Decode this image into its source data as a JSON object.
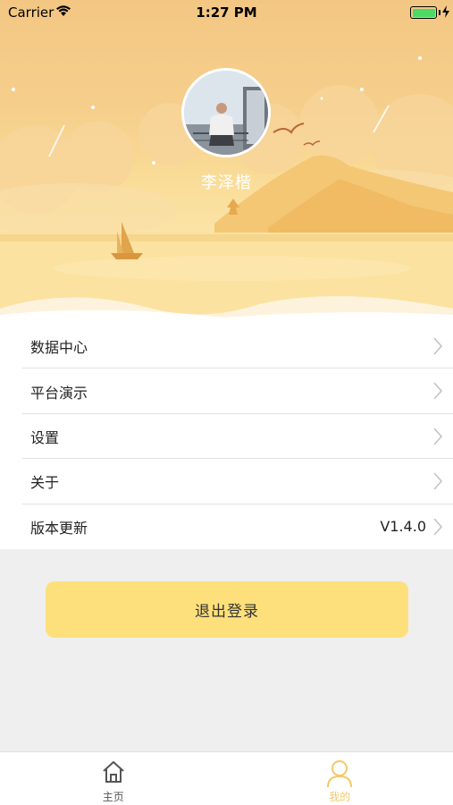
{
  "status_bar": {
    "carrier": "Carrier",
    "time": "1:27 PM"
  },
  "profile": {
    "username": "李泽楷"
  },
  "menu": {
    "items": [
      {
        "label": "数据中心",
        "value": ""
      },
      {
        "label": "平台演示",
        "value": ""
      },
      {
        "label": "设置",
        "value": ""
      },
      {
        "label": "关于",
        "value": ""
      },
      {
        "label": "版本更新",
        "value": "V1.4.0"
      }
    ]
  },
  "logout": {
    "label": "退出登录"
  },
  "tabbar": {
    "tabs": [
      {
        "label": "主页",
        "icon": "home-icon"
      },
      {
        "label": "我的",
        "icon": "person-icon"
      }
    ],
    "active_color": "#f2c86a",
    "inactive_color": "#555555"
  },
  "colors": {
    "accent": "#fde07b",
    "battery": "#4cd964"
  }
}
